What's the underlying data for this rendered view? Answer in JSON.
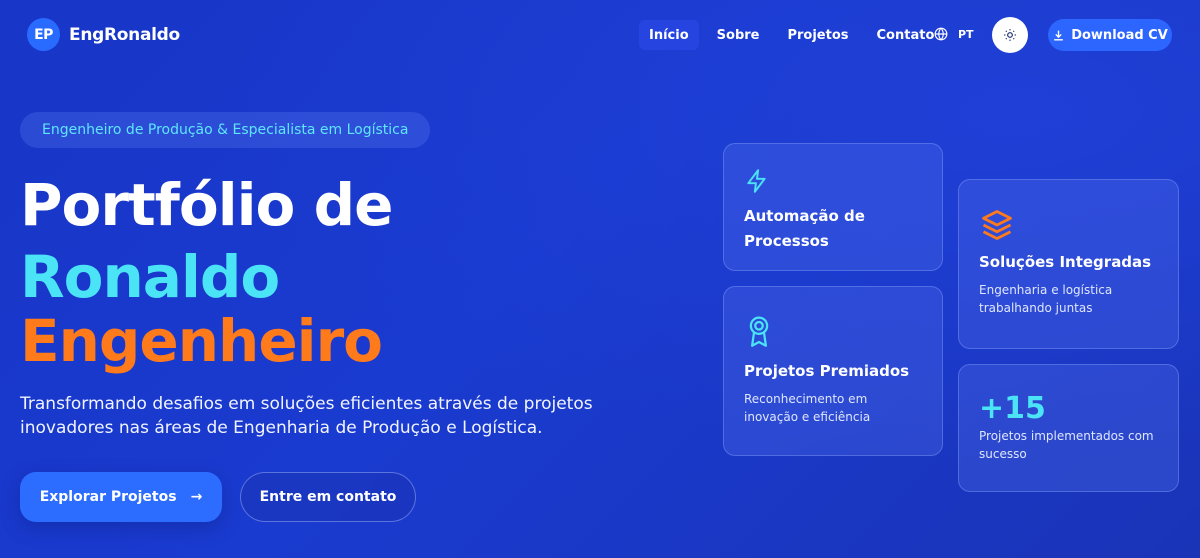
{
  "logo": {
    "badge": "EP",
    "name": "EngRonaldo"
  },
  "nav": {
    "links": [
      "Início",
      "Sobre",
      "Projetos",
      "Contato"
    ],
    "language": "PT",
    "download": "Download CV"
  },
  "hero": {
    "tagline": "Engenheiro de Produção & Especialista em Logística",
    "title_line1": "Portfólio de",
    "title_line2": "Ronaldo",
    "title_line3": "Engenheiro",
    "description": "Transformando desafios em soluções eficientes através de projetos inovadores nas áreas de Engenharia de Produção e Logística.",
    "primary_button": "Explorar Projetos",
    "secondary_button": "Entre em contato"
  },
  "cards": {
    "automation": {
      "title": "Automação de Processos",
      "icon": "lightning-icon"
    },
    "integrated": {
      "title": "Soluções Integradas",
      "subtitle": "Engenharia e logística trabalhando juntas",
      "icon": "layers-icon"
    },
    "awards": {
      "title": "Projetos Premiados",
      "subtitle": "Reconhecimento em inovação e eficiência",
      "icon": "award-icon"
    },
    "stats": {
      "value": "+15",
      "subtitle": "Projetos implementados com sucesso"
    }
  },
  "colors": {
    "accent_cyan": "#4be4f7",
    "accent_orange": "#ff7a1a",
    "brand_blue": "#2c6cff"
  }
}
